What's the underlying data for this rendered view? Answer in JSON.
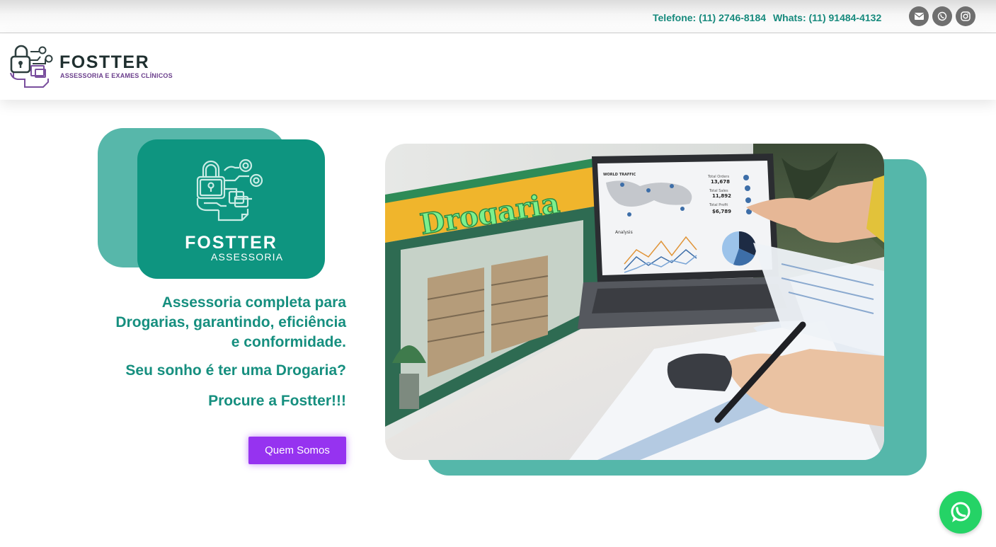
{
  "topbar": {
    "phone_label": "Telefone: (11) 2746-8184",
    "whats_label": "Whats: (11) 91484-4132",
    "social_icons": [
      "envelope-icon",
      "whatsapp-icon",
      "instagram-icon"
    ]
  },
  "header": {
    "logo_title": "FOSTTER",
    "logo_subtitle": "ASSESSORIA E EXAMES CLÍNICOS"
  },
  "hero": {
    "card_title": "FOSTTER",
    "card_subtitle": "ASSESSORIA",
    "headline": "Assessoria completa para Drogarias, garantindo, eficiência e conformidade.",
    "question": "Seu sonho é ter uma Drogaria?",
    "cta_text": "Procure a Fostter!!!",
    "button_label": "Quem Somos",
    "image": {
      "store_sign": "Drogaria",
      "laptop_map_title": "WORLD TRAFFIC",
      "laptop_analysis_title": "Analysis",
      "stats": [
        {
          "label": "Total Orders",
          "value": "13,678"
        },
        {
          "label": "Total Sales",
          "value": "11,892"
        },
        {
          "label": "Total Profit",
          "value": "$6,789"
        }
      ]
    }
  },
  "floating": {
    "icon": "whatsapp-icon"
  },
  "colors": {
    "teal": "#0e9580",
    "teal_light": "#57b7aa",
    "text_teal": "#168f7f",
    "purple": "#9633f0",
    "whatsapp_green": "#25d366"
  }
}
